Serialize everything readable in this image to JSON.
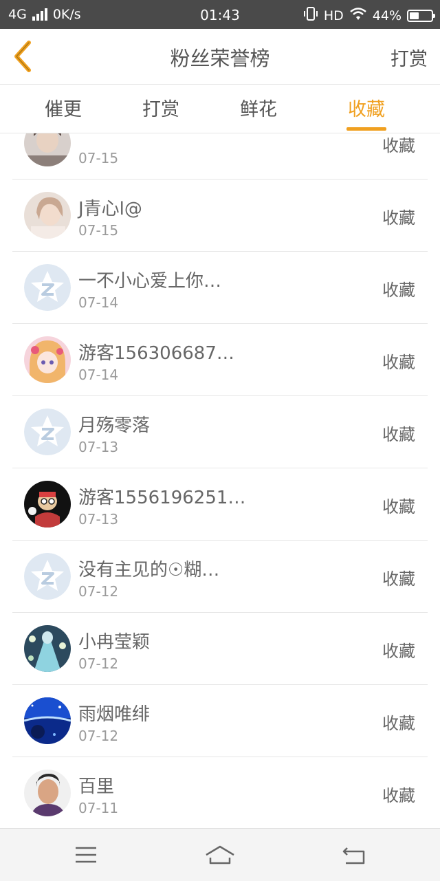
{
  "status_bar": {
    "network": "4G",
    "speed": "0K/s",
    "time": "01:43",
    "hd": "HD",
    "battery": "44%",
    "battery_level": 0.44
  },
  "header": {
    "title": "粉丝荣誉榜",
    "action": "打赏",
    "back_icon": "chevron-left-icon",
    "accent_color": "#f0a020"
  },
  "tabs": [
    {
      "label": "催更"
    },
    {
      "label": "打赏"
    },
    {
      "label": "鲜花"
    },
    {
      "label": "收藏",
      "active": true
    }
  ],
  "rows": [
    {
      "name": "",
      "date": "07-15",
      "action": "收藏",
      "avatar": "photo"
    },
    {
      "name": "J青心l@",
      "date": "07-15",
      "action": "收藏",
      "avatar": "photo"
    },
    {
      "name": "一不小心爱上你…",
      "date": "07-14",
      "action": "收藏",
      "avatar": "default-qq-icon"
    },
    {
      "name": "游客156306687…",
      "date": "07-14",
      "action": "收藏",
      "avatar": "anime"
    },
    {
      "name": "月殇零落",
      "date": "07-13",
      "action": "收藏",
      "avatar": "default-qq-icon"
    },
    {
      "name": "游客1556196251…",
      "date": "07-13",
      "action": "收藏",
      "avatar": "cartoon"
    },
    {
      "name": "没有主见的☉糊…",
      "date": "07-12",
      "action": "收藏",
      "avatar": "default-qq-icon"
    },
    {
      "name": "小冉莹颖",
      "date": "07-12",
      "action": "收藏",
      "avatar": "photo"
    },
    {
      "name": "雨烟唯绯",
      "date": "07-12",
      "action": "收藏",
      "avatar": "photo"
    },
    {
      "name": "百里",
      "date": "07-11",
      "action": "收藏",
      "avatar": "photo"
    }
  ],
  "nav": {
    "menu_icon": "menu-icon",
    "home_icon": "home-icon",
    "back_icon": "return-icon"
  }
}
